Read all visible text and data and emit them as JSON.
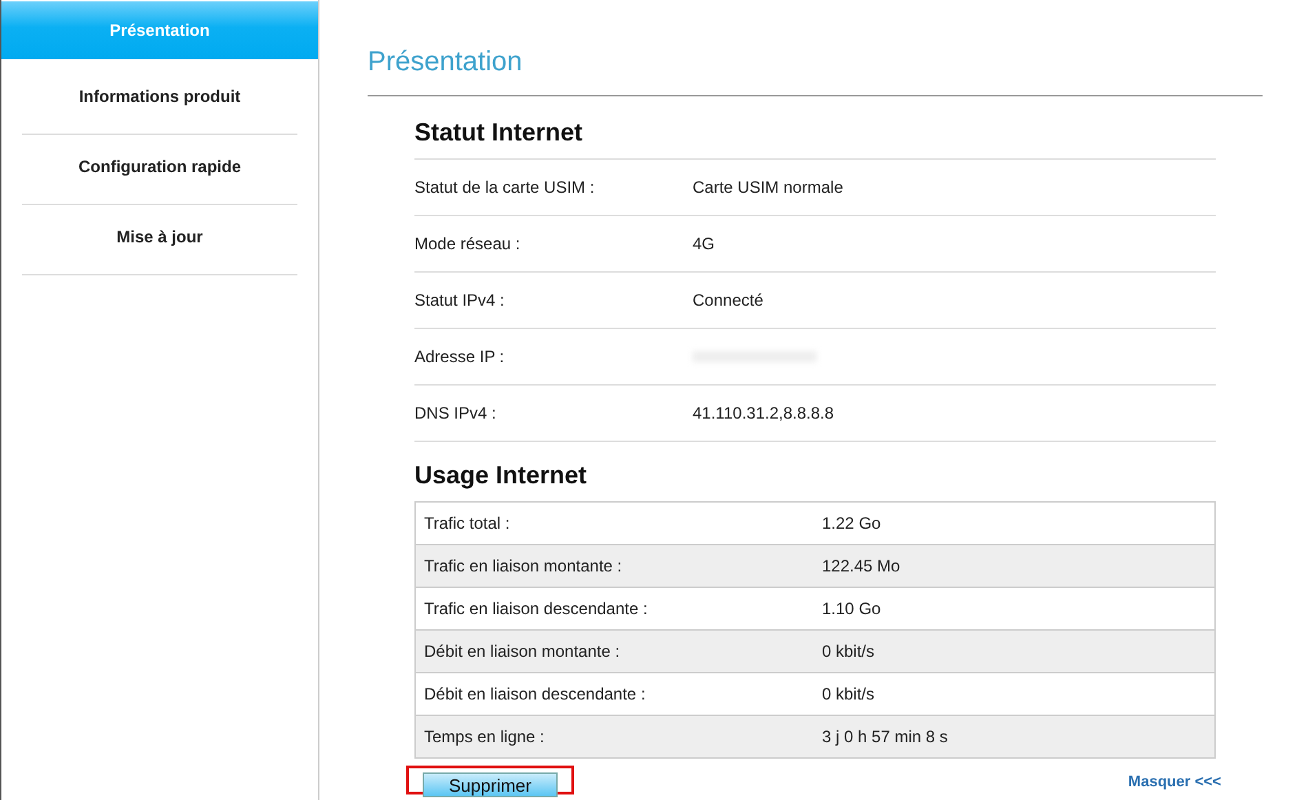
{
  "sidebar": {
    "items": [
      {
        "label": "Présentation",
        "selected": true
      },
      {
        "label": "Informations produit",
        "selected": false
      },
      {
        "label": "Configuration rapide",
        "selected": false
      },
      {
        "label": "Mise à jour",
        "selected": false
      }
    ]
  },
  "page_title": "Présentation",
  "internet_status": {
    "title": "Statut Internet",
    "rows": [
      {
        "label": "Statut de la carte USIM :",
        "value": "Carte USIM normale"
      },
      {
        "label": "Mode réseau :",
        "value": "4G"
      },
      {
        "label": "Statut IPv4 :",
        "value": "Connecté"
      },
      {
        "label": "Adresse IP :",
        "redacted": true
      },
      {
        "label": "DNS IPv4 :",
        "value": "41.110.31.2,8.8.8.8"
      }
    ]
  },
  "internet_usage": {
    "title": "Usage Internet",
    "rows": [
      {
        "label": "Trafic total :",
        "value": "1.22 Go"
      },
      {
        "label": "Trafic en liaison montante :",
        "value": "122.45 Mo"
      },
      {
        "label": "Trafic en liaison descendante :",
        "value": "1.10 Go"
      },
      {
        "label": "Débit en liaison montante :",
        "value": "0 kbit/s"
      },
      {
        "label": "Débit en liaison descendante :",
        "value": "0 kbit/s"
      },
      {
        "label": "Temps en ligne :",
        "value": "3 j 0 h 57 min 8 s"
      }
    ]
  },
  "clear_button": {
    "label": "Supprimer",
    "highlighted": true
  },
  "hide_link": "Masquer <<<"
}
